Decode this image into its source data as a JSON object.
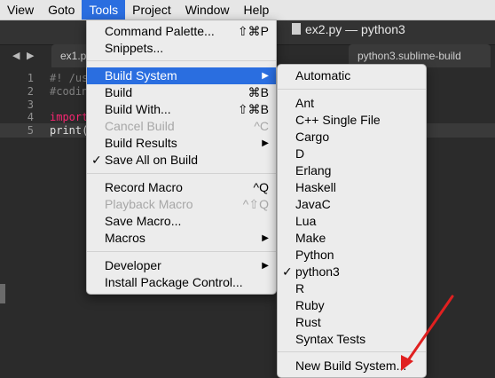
{
  "menubar": {
    "items": [
      {
        "label": "View"
      },
      {
        "label": "Goto"
      },
      {
        "label": "Tools",
        "active": true
      },
      {
        "label": "Project"
      },
      {
        "label": "Window"
      },
      {
        "label": "Help"
      }
    ]
  },
  "window": {
    "title": "ex2.py — python3"
  },
  "tabs": {
    "nav_left": "◀",
    "nav_right": "▶",
    "items": [
      {
        "label": "ex1.p"
      },
      {
        "label": "python3.sublime-build"
      }
    ]
  },
  "editor": {
    "line_numbers": [
      "1",
      "2",
      "3",
      "4",
      "5"
    ],
    "lines": [
      {
        "text": "#! /us",
        "color": "#7f7f7f"
      },
      {
        "text": "#codin",
        "color": "#7f7f7f"
      },
      {
        "text": "",
        "color": "#e0e0e0"
      },
      {
        "text": "import",
        "color": "#f92672"
      },
      {
        "text": "print(",
        "color": "#e0e0e0"
      }
    ]
  },
  "tools_menu": {
    "items": [
      {
        "label": "Command Palette...",
        "shortcut": "⇧⌘P"
      },
      {
        "label": "Snippets..."
      },
      {
        "label": "Build System",
        "submenu": true,
        "highlighted": true
      },
      {
        "label": "Build",
        "shortcut": "⌘B"
      },
      {
        "label": "Build With...",
        "shortcut": "⇧⌘B"
      },
      {
        "label": "Cancel Build",
        "shortcut": "^C",
        "disabled": true
      },
      {
        "label": "Build Results",
        "submenu": true
      },
      {
        "label": "Save All on Build",
        "checked": true
      },
      {
        "label": "Record Macro",
        "shortcut": "^Q"
      },
      {
        "label": "Playback Macro",
        "shortcut": "^⇧Q",
        "disabled": true
      },
      {
        "label": "Save Macro..."
      },
      {
        "label": "Macros",
        "submenu": true
      },
      {
        "label": "Developer",
        "submenu": true
      },
      {
        "label": "Install Package Control..."
      }
    ]
  },
  "build_system_menu": {
    "items": [
      {
        "label": "Automatic"
      },
      {
        "label": "Ant"
      },
      {
        "label": "C++ Single File"
      },
      {
        "label": "Cargo"
      },
      {
        "label": "D"
      },
      {
        "label": "Erlang"
      },
      {
        "label": "Haskell"
      },
      {
        "label": "JavaC"
      },
      {
        "label": "Lua"
      },
      {
        "label": "Make"
      },
      {
        "label": "Python"
      },
      {
        "label": "python3",
        "checked": true
      },
      {
        "label": "R"
      },
      {
        "label": "Ruby"
      },
      {
        "label": "Rust"
      },
      {
        "label": "Syntax Tests"
      },
      {
        "label": "New Build System..."
      }
    ]
  },
  "glyphs": {
    "check": "✓",
    "submenu_arrow": "▶"
  },
  "colors": {
    "accent": "#2a6ee0",
    "arrow": "#e02020"
  }
}
